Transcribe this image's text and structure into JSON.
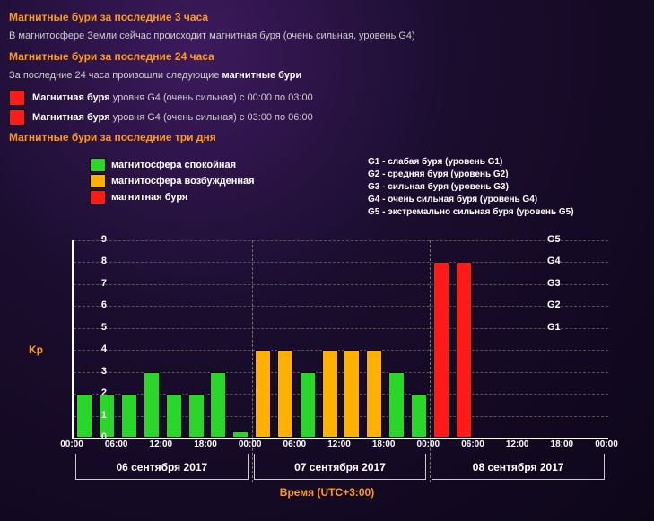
{
  "section3h": {
    "title": "Магнитные бури за последние 3 часа",
    "status": "В магнитосфере Земли сейчас происходит магнитная буря (очень сильная, уровень G4)"
  },
  "section24h": {
    "title": "Магнитные бури за последние 24 часа",
    "intro_prefix": "За последние 24 часа произошли следующие ",
    "intro_bold": "магнитные бури",
    "storms": [
      {
        "swatch": "sw-red",
        "bold": "Магнитная буря",
        "rest": " уровня G4 (очень сильная) с 00:00 по 03:00"
      },
      {
        "swatch": "sw-red",
        "bold": "Магнитная буря",
        "rest": " уровня G4 (очень сильная) с 03:00 по 06:00"
      }
    ]
  },
  "section3d": {
    "title": "Магнитные бури за последние три дня"
  },
  "legend_left": [
    {
      "color": "sw-green",
      "text": "магнитосфера спокойная"
    },
    {
      "color": "sw-orange",
      "text": "магнитосфера возбужденная"
    },
    {
      "color": "sw-red",
      "text": "магнитная буря"
    }
  ],
  "legend_right": [
    "G1 - слабая буря (уровень G1)",
    "G2 - средняя буря (уровень G2)",
    "G3 - сильная буря (уровень G3)",
    "G4 - очень сильная буря (уровень G4)",
    "G5 - экстремально сильная буря (уровень G5)"
  ],
  "axes": {
    "y_label": "Kp",
    "y_ticks": [
      "0",
      "1",
      "2",
      "3",
      "4",
      "5",
      "6",
      "7",
      "8",
      "9"
    ],
    "g_ticks": {
      "5": "G1",
      "6": "G2",
      "7": "G3",
      "8": "G4",
      "9": "G5"
    },
    "x_label": "Время (UTC+3:00)"
  },
  "days": [
    {
      "label": "06 сентября 2017",
      "ticks": [
        "00:00",
        "06:00",
        "12:00",
        "18:00"
      ]
    },
    {
      "label": "07 сентября 2017",
      "ticks": [
        "00:00",
        "06:00",
        "12:00",
        "18:00"
      ]
    },
    {
      "label": "08 сентября 2017",
      "ticks": [
        "00:00",
        "06:00",
        "12:00",
        "18:00",
        "00:00"
      ]
    }
  ],
  "chart_data": {
    "type": "bar",
    "title": "Магнитные бури за последние три дня",
    "xlabel": "Время (UTC+3:00)",
    "ylabel": "Kp",
    "ylim": [
      0,
      9
    ],
    "x": [
      "06 00:00",
      "06 03:00",
      "06 06:00",
      "06 09:00",
      "06 12:00",
      "06 15:00",
      "06 18:00",
      "06 21:00",
      "07 00:00",
      "07 03:00",
      "07 06:00",
      "07 09:00",
      "07 12:00",
      "07 15:00",
      "07 18:00",
      "07 21:00",
      "08 00:00",
      "08 03:00"
    ],
    "values": [
      2,
      2,
      2,
      3,
      2,
      2,
      3,
      0.3,
      4,
      4,
      3,
      4,
      4,
      4,
      3,
      2,
      8,
      8
    ],
    "colors": [
      "green",
      "green",
      "green",
      "green",
      "green",
      "green",
      "green",
      "green",
      "orange",
      "orange",
      "green",
      "orange",
      "orange",
      "orange",
      "green",
      "green",
      "red",
      "red"
    ],
    "color_map": {
      "green": "#2bd62b",
      "orange": "#ffb000",
      "red": "#ff1a1a"
    }
  }
}
